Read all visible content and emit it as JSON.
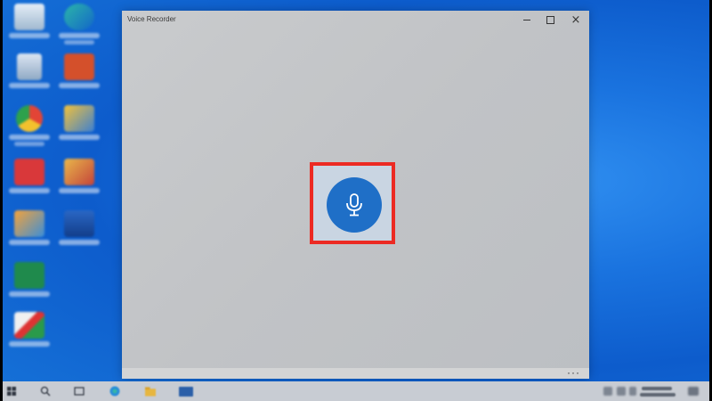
{
  "window": {
    "title": "Voice Recorder",
    "record_button_icon": "microphone-icon",
    "more_label": "···"
  },
  "taskbar": {
    "icons": [
      "windows-start-icon",
      "search-icon",
      "task-view-icon",
      "edge-icon",
      "file-explorer-icon",
      "app-icon"
    ]
  },
  "colors": {
    "accent": "#1f6fc7",
    "highlight": "#ec2a23",
    "desktop": "#1a73df"
  }
}
